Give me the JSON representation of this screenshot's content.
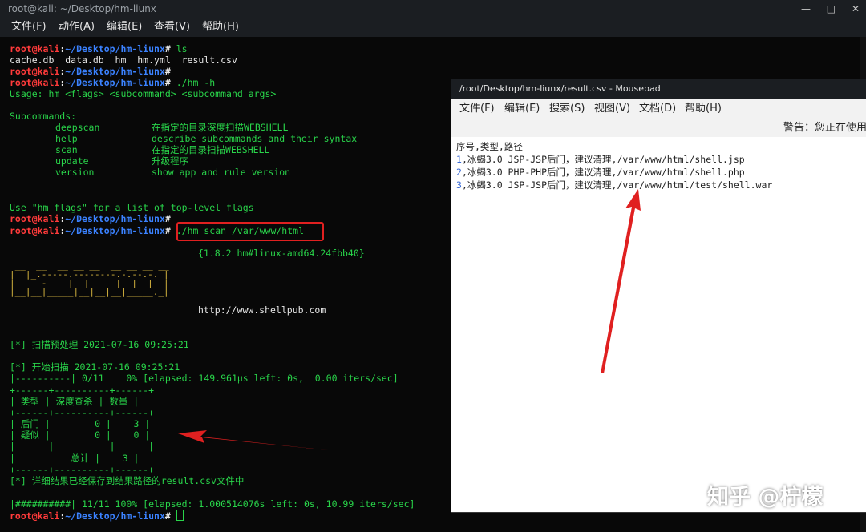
{
  "terminal": {
    "title": "root@kali: ~/Desktop/hm-liunx",
    "menu": [
      "文件(F)",
      "动作(A)",
      "编辑(E)",
      "查看(V)",
      "帮助(H)"
    ],
    "prompt": {
      "user": "root@kali",
      "path": "~/Desktop/hm-liunx",
      "symbol": "#"
    },
    "commands": [
      "ls",
      "",
      "./hm -h",
      "",
      "./hm scan /var/www/html",
      ""
    ],
    "ls_output": "cache.db  data.db  hm  hm.yml  result.csv",
    "usage": "Usage: hm <flags> <subcommand> <subcommand args>",
    "subcommands_header": "Subcommands:",
    "subcommands": [
      {
        "name": "deepscan",
        "desc": "在指定的目录深度扫描WEBSHELL"
      },
      {
        "name": "help",
        "desc": "describe subcommands and their syntax"
      },
      {
        "name": "scan",
        "desc": "在指定的目录扫描WEBSHELL"
      },
      {
        "name": "update",
        "desc": "升级程序"
      },
      {
        "name": "version",
        "desc": "show app and rule version"
      }
    ],
    "flags_hint": "Use \"hm flags\" for a list of top-level flags",
    "version_line": "{1.8.2 hm#linux-amd64.24fbb40}",
    "ascii_logo": " __  __  __ __ __  __ __ __ __ \n|  |_.-----.--------.-.--.-. |\n|     -  __|  |     |  |  |  |\n|__|__|_____|__|__|__|_____._|",
    "url": "http://www.shellpub.com",
    "preprocess": "[*] 扫描预处理 2021-07-16 09:25:21",
    "start": "[*] 开始扫描 2021-07-16 09:25:21",
    "progress_start": "|----------| 0/11    0% [elapsed: 149.961µs left: 0s,  0.00 iters/sec]",
    "table_border": "+------+----------+------+",
    "table_header": "| 类型 | 深度查杀 | 数量 |",
    "table_rows": [
      "| 后门 |        0 |    3 |",
      "| 疑似 |        0 |    0 |"
    ],
    "table_blank": "|      |          |      |",
    "table_total": "|          总计 |    3 |",
    "saved": "[*] 详细结果已经保存到结果路径的result.csv文件中",
    "progress_end": "|##########| 11/11 100% [elapsed: 1.000514076s left: 0s, 10.99 iters/sec]",
    "window_buttons": [
      "—",
      "□",
      "✕"
    ]
  },
  "mousepad": {
    "title": "/root/Desktop/hm-liunx/result.csv - Mousepad",
    "menu": [
      "文件(F)",
      "编辑(E)",
      "搜索(S)",
      "视图(V)",
      "文档(D)",
      "帮助(H)"
    ],
    "warning": "警告：您正在使用",
    "lines": [
      {
        "num": "",
        "text": "序号,类型,路径"
      },
      {
        "num": "1",
        "text": ",冰蝎3.0 JSP-JSP后门，建议清理,/var/www/html/shell.jsp"
      },
      {
        "num": "2",
        "text": ",冰蝎3.0 PHP-PHP后门，建议清理,/var/www/html/shell.php"
      },
      {
        "num": "3",
        "text": ",冰蝎3.0 JSP-JSP后门，建议清理,/var/www/html/test/shell.war"
      }
    ]
  },
  "watermark": "知乎 @柠檬",
  "colors": {
    "arrow": "#e02020",
    "highlight": "#e02020",
    "terminal_green": "#29d44a"
  }
}
